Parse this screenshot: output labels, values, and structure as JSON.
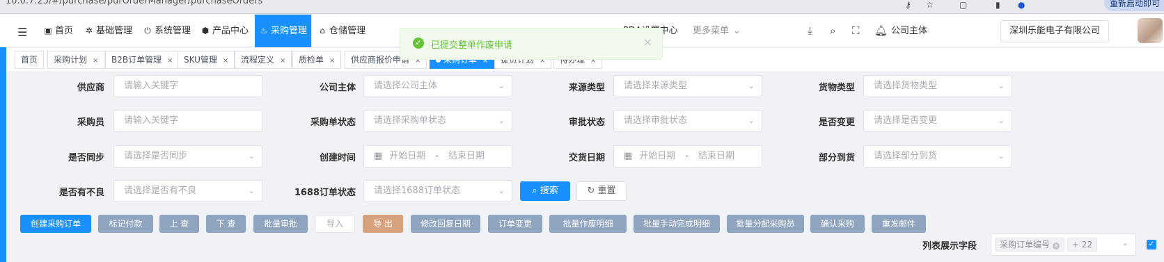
{
  "browser": {
    "url": "10.0.7.25/#/purchase/purOrderManager/purchaseOrders",
    "icons": [
      "key-icon",
      "star-icon",
      "extension-icon",
      "sidepanel-icon",
      "profile-icon"
    ],
    "restart_label": "重新启动即可"
  },
  "topnav": {
    "items": [
      {
        "label": "首页",
        "icon": "monitor-icon"
      },
      {
        "label": "基础管理",
        "icon": "gear-icon"
      },
      {
        "label": "系统管理",
        "icon": "power-icon"
      },
      {
        "label": "产品中心",
        "icon": "cube-icon"
      },
      {
        "label": "采购管理",
        "icon": "basket-icon",
        "active": true
      },
      {
        "label": "仓储管理",
        "icon": "warehouse-icon"
      },
      {
        "label": "PDA设置中心",
        "icon": "phone-icon"
      },
      {
        "label": "更多菜单",
        "icon": "chevron-down-icon",
        "muted": true
      }
    ],
    "company_label": "公司主体",
    "company_value": "深圳乐能电子有限公司"
  },
  "toast": {
    "message": "已提交整单作废申请",
    "type": "success"
  },
  "tags": [
    {
      "label": "首页",
      "closable": false
    },
    {
      "label": "采购计划",
      "closable": true
    },
    {
      "label": "B2B订单管理",
      "closable": true
    },
    {
      "label": "SKU管理",
      "closable": true
    },
    {
      "label": "流程定义",
      "closable": true
    },
    {
      "label": "质检单",
      "closable": true
    },
    {
      "label": "供应商报价申请",
      "closable": true
    },
    {
      "label": "采购订单",
      "closable": true,
      "active": true
    },
    {
      "label": "提货计划",
      "closable": true
    },
    {
      "label": "待办理",
      "closable": true
    }
  ],
  "filters": {
    "supplier": {
      "label": "供应商",
      "placeholder": "请输入关键字"
    },
    "company": {
      "label": "公司主体",
      "placeholder": "请选择公司主体"
    },
    "source_type": {
      "label": "来源类型",
      "placeholder": "请选择来源类型"
    },
    "goods_type": {
      "label": "货物类型",
      "placeholder": "请选择货物类型"
    },
    "buyer": {
      "label": "采购员",
      "placeholder": "请输入关键字"
    },
    "order_status": {
      "label": "采购单状态",
      "placeholder": "请选择采购单状态"
    },
    "approval_status": {
      "label": "审批状态",
      "placeholder": "请选择审批状态"
    },
    "changed": {
      "label": "是否变更",
      "placeholder": "请选择是否变更"
    },
    "synced": {
      "label": "是否同步",
      "placeholder": "请选择是否同步"
    },
    "created": {
      "label": "创建时间",
      "start": "开始日期",
      "sep": "-",
      "end": "结束日期"
    },
    "delivery": {
      "label": "交货日期",
      "start": "开始日期",
      "sep": "-",
      "end": "结束日期"
    },
    "partial": {
      "label": "部分到货",
      "placeholder": "请选择部分到货"
    },
    "defect": {
      "label": "是否有不良",
      "placeholder": "请选择是否有不良"
    },
    "status1688": {
      "label": "1688订单状态",
      "placeholder": "请选择1688订单状态"
    }
  },
  "search_label": "搜索",
  "reset_label": "重置",
  "actions": [
    {
      "label": "创建采购订单",
      "style": "blue"
    },
    {
      "label": "标记付款",
      "style": "gray"
    },
    {
      "label": "上 查",
      "style": "gray"
    },
    {
      "label": "下 查",
      "style": "gray"
    },
    {
      "label": "批量审批",
      "style": "gray"
    },
    {
      "label": "导入",
      "style": "disabled"
    },
    {
      "label": "导 出",
      "style": "tan"
    },
    {
      "label": "修改回复日期",
      "style": "gray"
    },
    {
      "label": "订单变更",
      "style": "gray"
    },
    {
      "label": "批量作废明细",
      "style": "gray"
    },
    {
      "label": "批量手动完成明细",
      "style": "gray"
    },
    {
      "label": "批量分配采购员",
      "style": "gray"
    },
    {
      "label": "确认采购",
      "style": "gray"
    },
    {
      "label": "重发邮件",
      "style": "gray"
    }
  ],
  "columns_field": {
    "label": "列表展示字段",
    "chip": "采购订单编号",
    "more": "+ 22"
  },
  "colors": {
    "primary": "#1890ff",
    "success": "#67c23a",
    "action_gray": "#8ea4bf",
    "export_tan": "#d7a37f"
  }
}
